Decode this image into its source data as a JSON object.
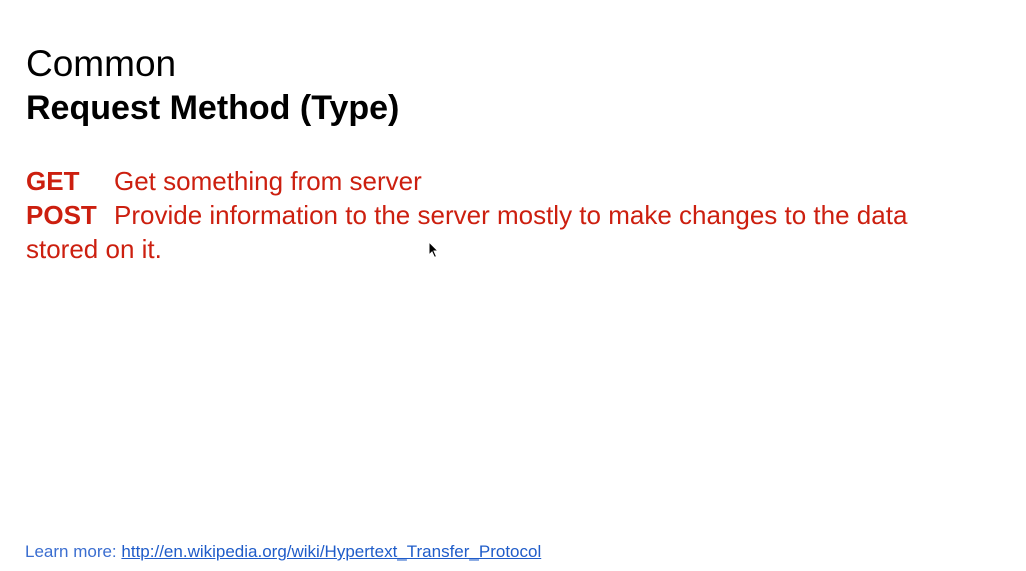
{
  "slide": {
    "title_line1": "Common",
    "title_line2": "Request Method (Type)",
    "methods": [
      {
        "name": "GET",
        "description": "Get something from server"
      },
      {
        "name": "POST",
        "description": "Provide information to the server mostly to make changes to the data stored on it."
      }
    ],
    "footer": {
      "label": "Learn more:",
      "link_text": "http://en.wikipedia.org/wiki/Hypertext_Transfer_Protocol"
    }
  },
  "colors": {
    "title": "#000000",
    "method_text": "#cc1f0f",
    "footer_label": "#3b6ed0",
    "link": "#1f5cc9"
  },
  "icons": {
    "cursor": "mouse-pointer-icon"
  }
}
